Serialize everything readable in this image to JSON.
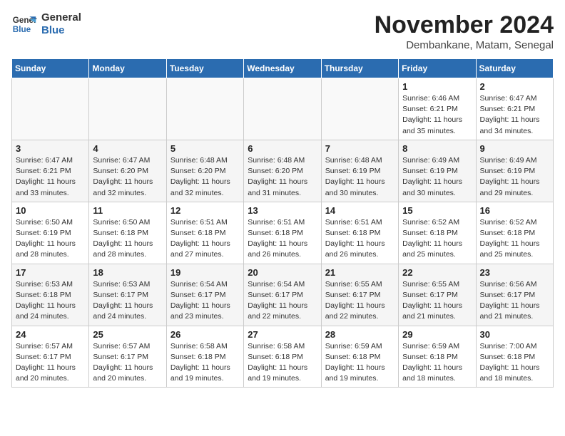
{
  "logo": {
    "line1": "General",
    "line2": "Blue"
  },
  "title": "November 2024",
  "subtitle": "Dembankane, Matam, Senegal",
  "weekdays": [
    "Sunday",
    "Monday",
    "Tuesday",
    "Wednesday",
    "Thursday",
    "Friday",
    "Saturday"
  ],
  "weeks": [
    [
      {
        "day": "",
        "info": ""
      },
      {
        "day": "",
        "info": ""
      },
      {
        "day": "",
        "info": ""
      },
      {
        "day": "",
        "info": ""
      },
      {
        "day": "",
        "info": ""
      },
      {
        "day": "1",
        "info": "Sunrise: 6:46 AM\nSunset: 6:21 PM\nDaylight: 11 hours\nand 35 minutes."
      },
      {
        "day": "2",
        "info": "Sunrise: 6:47 AM\nSunset: 6:21 PM\nDaylight: 11 hours\nand 34 minutes."
      }
    ],
    [
      {
        "day": "3",
        "info": "Sunrise: 6:47 AM\nSunset: 6:21 PM\nDaylight: 11 hours\nand 33 minutes."
      },
      {
        "day": "4",
        "info": "Sunrise: 6:47 AM\nSunset: 6:20 PM\nDaylight: 11 hours\nand 32 minutes."
      },
      {
        "day": "5",
        "info": "Sunrise: 6:48 AM\nSunset: 6:20 PM\nDaylight: 11 hours\nand 32 minutes."
      },
      {
        "day": "6",
        "info": "Sunrise: 6:48 AM\nSunset: 6:20 PM\nDaylight: 11 hours\nand 31 minutes."
      },
      {
        "day": "7",
        "info": "Sunrise: 6:48 AM\nSunset: 6:19 PM\nDaylight: 11 hours\nand 30 minutes."
      },
      {
        "day": "8",
        "info": "Sunrise: 6:49 AM\nSunset: 6:19 PM\nDaylight: 11 hours\nand 30 minutes."
      },
      {
        "day": "9",
        "info": "Sunrise: 6:49 AM\nSunset: 6:19 PM\nDaylight: 11 hours\nand 29 minutes."
      }
    ],
    [
      {
        "day": "10",
        "info": "Sunrise: 6:50 AM\nSunset: 6:19 PM\nDaylight: 11 hours\nand 28 minutes."
      },
      {
        "day": "11",
        "info": "Sunrise: 6:50 AM\nSunset: 6:18 PM\nDaylight: 11 hours\nand 28 minutes."
      },
      {
        "day": "12",
        "info": "Sunrise: 6:51 AM\nSunset: 6:18 PM\nDaylight: 11 hours\nand 27 minutes."
      },
      {
        "day": "13",
        "info": "Sunrise: 6:51 AM\nSunset: 6:18 PM\nDaylight: 11 hours\nand 26 minutes."
      },
      {
        "day": "14",
        "info": "Sunrise: 6:51 AM\nSunset: 6:18 PM\nDaylight: 11 hours\nand 26 minutes."
      },
      {
        "day": "15",
        "info": "Sunrise: 6:52 AM\nSunset: 6:18 PM\nDaylight: 11 hours\nand 25 minutes."
      },
      {
        "day": "16",
        "info": "Sunrise: 6:52 AM\nSunset: 6:18 PM\nDaylight: 11 hours\nand 25 minutes."
      }
    ],
    [
      {
        "day": "17",
        "info": "Sunrise: 6:53 AM\nSunset: 6:18 PM\nDaylight: 11 hours\nand 24 minutes."
      },
      {
        "day": "18",
        "info": "Sunrise: 6:53 AM\nSunset: 6:17 PM\nDaylight: 11 hours\nand 24 minutes."
      },
      {
        "day": "19",
        "info": "Sunrise: 6:54 AM\nSunset: 6:17 PM\nDaylight: 11 hours\nand 23 minutes."
      },
      {
        "day": "20",
        "info": "Sunrise: 6:54 AM\nSunset: 6:17 PM\nDaylight: 11 hours\nand 22 minutes."
      },
      {
        "day": "21",
        "info": "Sunrise: 6:55 AM\nSunset: 6:17 PM\nDaylight: 11 hours\nand 22 minutes."
      },
      {
        "day": "22",
        "info": "Sunrise: 6:55 AM\nSunset: 6:17 PM\nDaylight: 11 hours\nand 21 minutes."
      },
      {
        "day": "23",
        "info": "Sunrise: 6:56 AM\nSunset: 6:17 PM\nDaylight: 11 hours\nand 21 minutes."
      }
    ],
    [
      {
        "day": "24",
        "info": "Sunrise: 6:57 AM\nSunset: 6:17 PM\nDaylight: 11 hours\nand 20 minutes."
      },
      {
        "day": "25",
        "info": "Sunrise: 6:57 AM\nSunset: 6:17 PM\nDaylight: 11 hours\nand 20 minutes."
      },
      {
        "day": "26",
        "info": "Sunrise: 6:58 AM\nSunset: 6:18 PM\nDaylight: 11 hours\nand 19 minutes."
      },
      {
        "day": "27",
        "info": "Sunrise: 6:58 AM\nSunset: 6:18 PM\nDaylight: 11 hours\nand 19 minutes."
      },
      {
        "day": "28",
        "info": "Sunrise: 6:59 AM\nSunset: 6:18 PM\nDaylight: 11 hours\nand 19 minutes."
      },
      {
        "day": "29",
        "info": "Sunrise: 6:59 AM\nSunset: 6:18 PM\nDaylight: 11 hours\nand 18 minutes."
      },
      {
        "day": "30",
        "info": "Sunrise: 7:00 AM\nSunset: 6:18 PM\nDaylight: 11 hours\nand 18 minutes."
      }
    ]
  ]
}
